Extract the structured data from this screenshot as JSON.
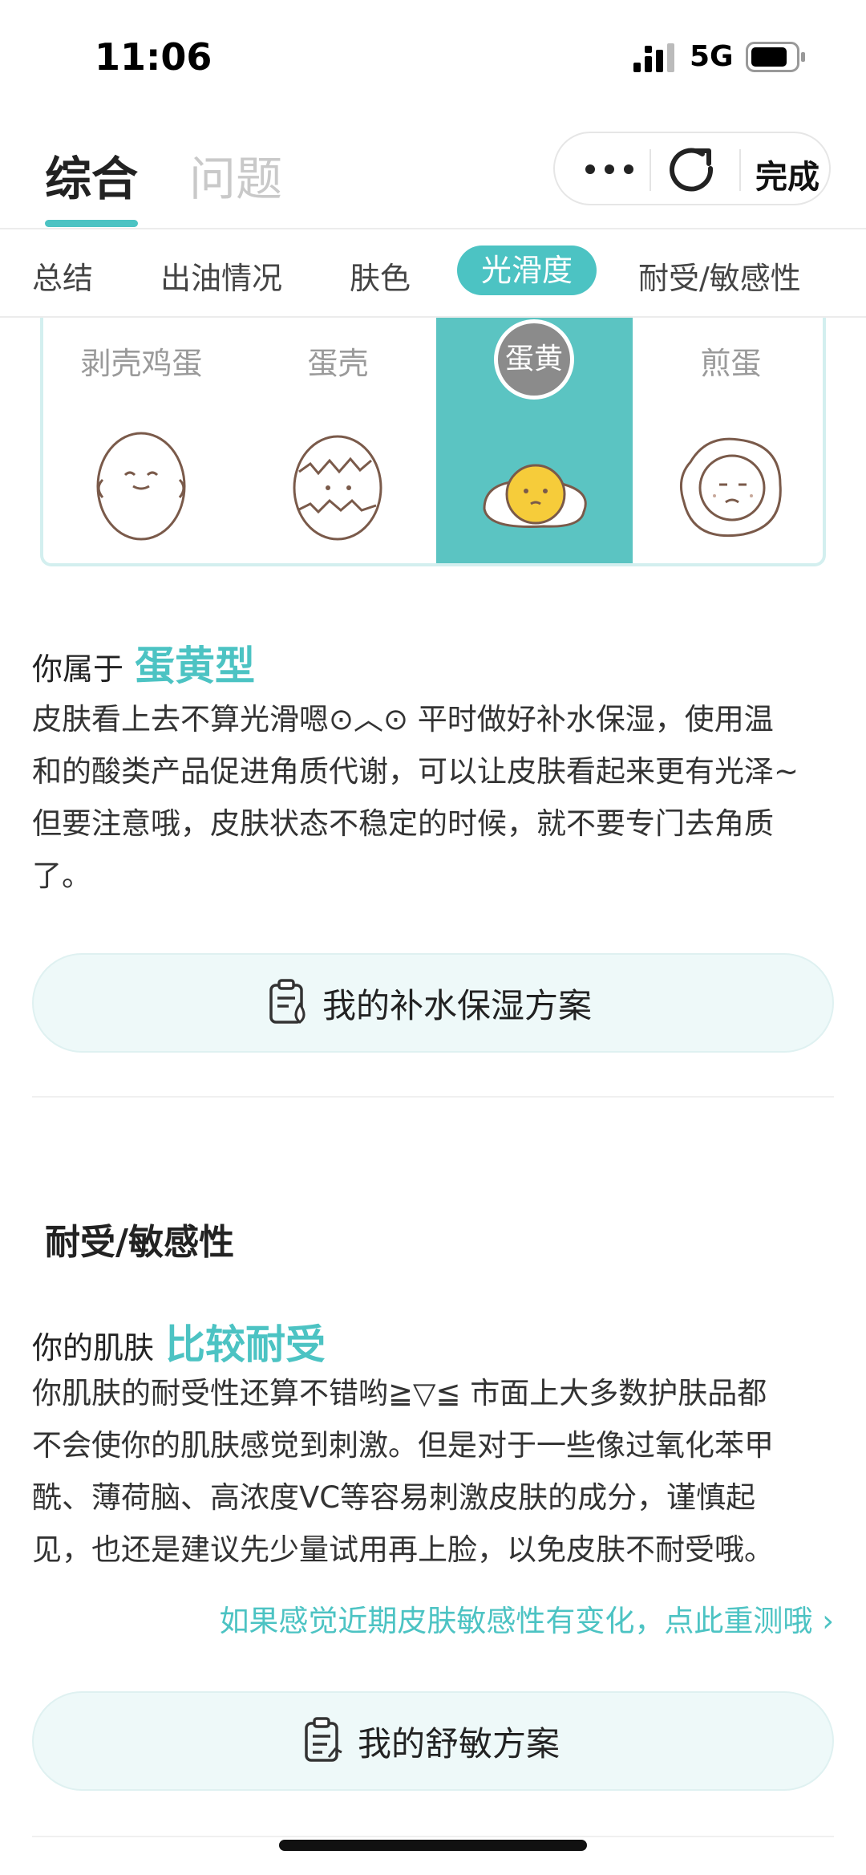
{
  "status": {
    "time": "11:06",
    "network": "5G"
  },
  "header": {
    "tabs": [
      {
        "label": "综合",
        "active": true
      },
      {
        "label": "问题",
        "active": false
      }
    ],
    "capsule": {
      "done_label": "完成"
    }
  },
  "categories": [
    "总结",
    "出油情况",
    "肤色",
    "光滑度",
    "耐受/敏感性"
  ],
  "selected_category": "光滑度",
  "eggs": [
    {
      "label": "剥壳鸡蛋",
      "icon": "peeled-egg-icon"
    },
    {
      "label": "蛋壳",
      "icon": "cracked-egg-icon"
    },
    {
      "label": "蛋黄",
      "icon": "egg-yolk-icon",
      "selected": true
    },
    {
      "label": "煎蛋",
      "icon": "fried-egg-icon"
    }
  ],
  "smoothness": {
    "prefix": "你属于",
    "result": "蛋黄型",
    "lines": [
      "皮肤看上去不算光滑嗯⊙︿⊙ 平时做好补水保湿，使用温",
      "和的酸类产品促进角质代谢，可以让皮肤看起来更有光泽~",
      "但要注意哦，皮肤状态不稳定的时候，就不要专门去角质",
      "了。"
    ],
    "plan_button": "我的补水保湿方案"
  },
  "sensitivity": {
    "title": "耐受/敏感性",
    "prefix": "你的肌肤",
    "result": "比较耐受",
    "lines": [
      "你肌肤的耐受性还算不错哟≧▽≦ 市面上大多数护肤品都",
      "不会使你的肌肤感觉到刺激。但是对于一些像过氧化苯甲",
      "酰、薄荷脑、高浓度VC等容易刺激皮肤的成分，谨慎起",
      "见，也还是建议先少量试用再上脸，以免皮肤不耐受哦。"
    ],
    "retest_link": "如果感觉近期皮肤敏感性有变化，点此重测哦 ›",
    "plan_button": "我的舒敏方案"
  },
  "colors": {
    "accent": "#4cc3c3",
    "selected_bg": "#5bc4c2",
    "button_bg": "#eef9f9"
  }
}
